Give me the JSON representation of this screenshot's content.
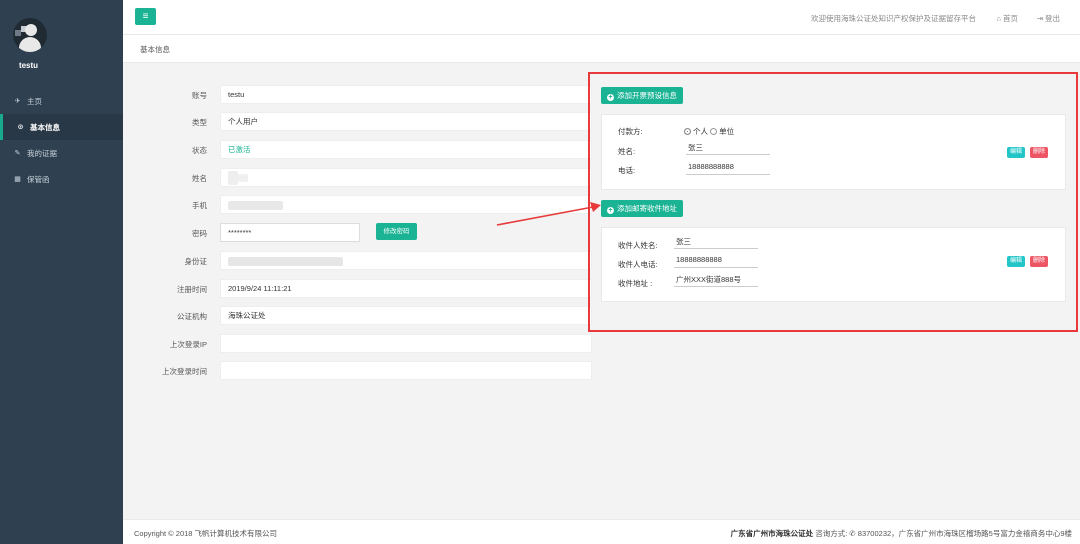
{
  "sidebar": {
    "username": "testu",
    "items": [
      {
        "label": "主页",
        "icon": "✈"
      },
      {
        "label": "基本信息",
        "icon": "⊙"
      },
      {
        "label": "我的证据",
        "icon": "✎"
      },
      {
        "label": "保管函",
        "icon": "▦"
      }
    ]
  },
  "topbar": {
    "menu_icon": "≡",
    "welcome": "欢迎使用海珠公证处知识产权保护及证据留存平台",
    "home_label": "首页",
    "home_icon": "⌂",
    "logout_label": "登出",
    "logout_icon": "⇥"
  },
  "breadcrumb": "基本信息",
  "form": {
    "account": {
      "label": "账号",
      "value": "testu"
    },
    "type": {
      "label": "类型",
      "value": "个人用户"
    },
    "status": {
      "label": "状态",
      "value": "已激活"
    },
    "name": {
      "label": "姓名"
    },
    "phone": {
      "label": "手机"
    },
    "password": {
      "label": "密码",
      "value": "********",
      "button": "修改密码"
    },
    "idcard": {
      "label": "身份证"
    },
    "register_time": {
      "label": "注册时间",
      "value": "2019/9/24 11:11:21"
    },
    "notary": {
      "label": "公证机构",
      "value": "海珠公证处"
    },
    "last_ip": {
      "label": "上次登录IP",
      "value": ""
    },
    "last_time": {
      "label": "上次登录时间",
      "value": ""
    }
  },
  "invoice": {
    "add_button": "添加开票预设信息",
    "payer_label": "付款方:",
    "payer_options": [
      "个人",
      "单位"
    ],
    "name_label": "姓名:",
    "name_value": "张三",
    "phone_label": "电话:",
    "phone_value": "18888888888",
    "edit": "编辑",
    "delete": "删除"
  },
  "address": {
    "add_button": "添加邮寄收件地址",
    "recipient_label": "收件人姓名:",
    "recipient_value": "张三",
    "phone_label": "收件人电话:",
    "phone_value": "18888888888",
    "address_label": "收件地址  :",
    "address_value": "广州XXX街道888号",
    "edit": "编辑",
    "delete": "删除"
  },
  "footer": {
    "copyright": "Copyright © 2018 飞帆计算机技术有限公司",
    "org": "广东省广州市海珠公证处",
    "contact": " 咨询方式: ",
    "phone_icon": "✆",
    "phone": " 83700232，广东省广州市海珠区榴场路5号富力金禧商务中心9楼"
  },
  "colors": {
    "accent": "#1ab394",
    "sidebar": "#2f4050",
    "highlight": "#e83a3a"
  }
}
